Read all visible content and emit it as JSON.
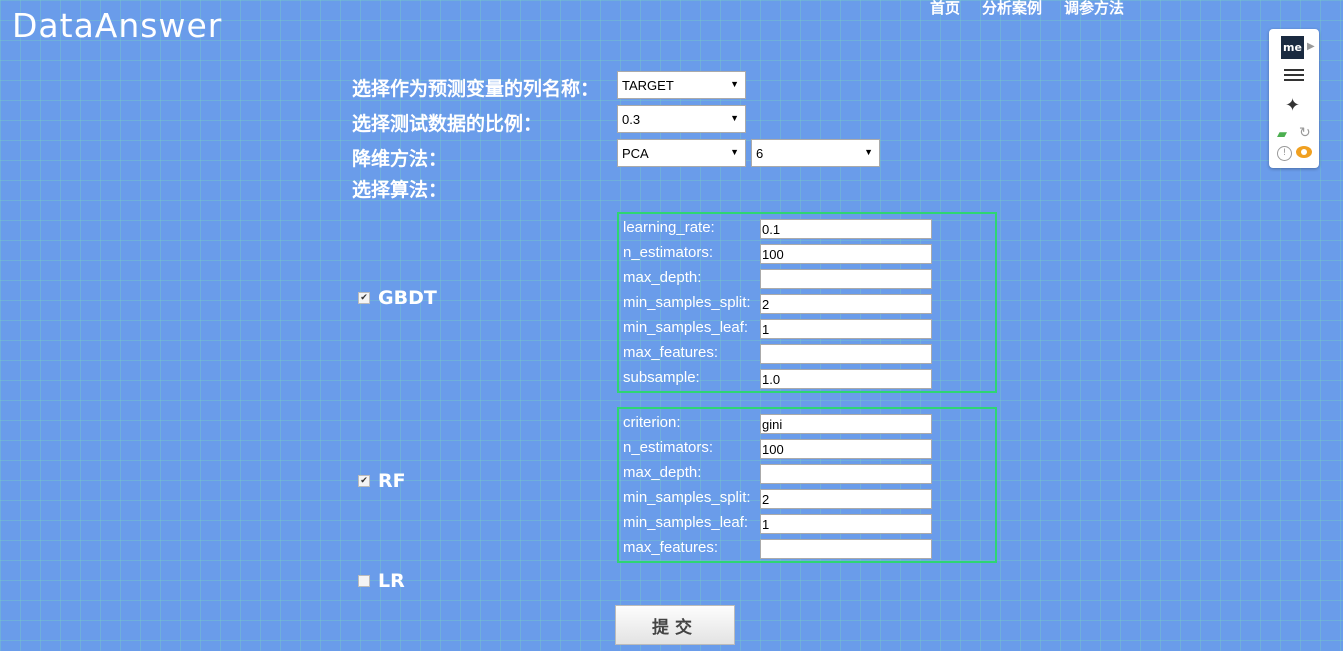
{
  "header": {
    "logo": "DataAnswer",
    "nav": [
      "首页",
      "分析案例",
      "调参方法"
    ]
  },
  "form": {
    "target_label": "选择作为预测变量的列名称：",
    "target_value": "TARGET",
    "test_ratio_label": "选择测试数据的比例：",
    "test_ratio_value": "0.3",
    "dim_reduce_label": "降维方法：",
    "dim_reduce_method": "PCA",
    "dim_reduce_n": "6",
    "algo_label": "选择算法："
  },
  "algorithms": [
    {
      "name": "GBDT",
      "checked": true,
      "params": [
        {
          "label": "learning_rate:",
          "value": "0.1"
        },
        {
          "label": "n_estimators:",
          "value": "100"
        },
        {
          "label": "max_depth:",
          "value": ""
        },
        {
          "label": "min_samples_split:",
          "value": "2"
        },
        {
          "label": "min_samples_leaf:",
          "value": "1"
        },
        {
          "label": "max_features:",
          "value": ""
        },
        {
          "label": "subsample:",
          "value": "1.0"
        }
      ]
    },
    {
      "name": "RF",
      "checked": true,
      "params": [
        {
          "label": "criterion:",
          "value": "gini"
        },
        {
          "label": "n_estimators:",
          "value": "100"
        },
        {
          "label": "max_depth:",
          "value": ""
        },
        {
          "label": "min_samples_split:",
          "value": "2"
        },
        {
          "label": "min_samples_leaf:",
          "value": "1"
        },
        {
          "label": "max_features:",
          "value": ""
        }
      ]
    },
    {
      "name": "LR",
      "checked": false,
      "params": []
    }
  ],
  "submit_label": "提交",
  "toolbar": {
    "me_label": "me",
    "icons": [
      "me-extension-icon",
      "play-arrow-icon",
      "hamburger-menu-icon",
      "magic-wand-icon",
      "cast-icon",
      "refresh-icon",
      "warning-icon",
      "eye-icon"
    ],
    "colors": {
      "cast": "#4caf50",
      "eye": "#f0a020"
    }
  },
  "colors": {
    "background": "#6a9cea",
    "box_border": "#2ed573"
  }
}
